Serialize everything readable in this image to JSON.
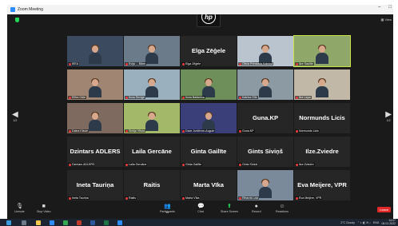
{
  "window": {
    "title": "Zoom Meeting",
    "minimize": "–",
    "maximize": "□"
  },
  "header": {
    "logo_text": "hp",
    "view_label": "View"
  },
  "nav": {
    "left_arrow": "◀",
    "left_page": "1/2",
    "right_arrow": "▶",
    "right_page": "1/2"
  },
  "tiles": [
    {
      "label": "IEEA",
      "big": "",
      "video": true
    },
    {
      "label": "Evija ... Bāne",
      "big": "",
      "video": true
    },
    {
      "label": "Elga Zēģele",
      "big": "Elga Zēģele",
      "video": false
    },
    {
      "label": "Olivia Prinstada Kalniņa",
      "big": "",
      "video": true
    },
    {
      "label": "Ilze Saulīte",
      "big": "",
      "video": true,
      "active": true
    },
    {
      "label": "Elītra Odle",
      "big": "",
      "video": true
    },
    {
      "label": "Ilona Ševige",
      "big": "",
      "video": true
    },
    {
      "label": "Ilona Baldzena",
      "big": "",
      "video": true
    },
    {
      "label": "Katrina Sīle",
      "big": "",
      "video": true
    },
    {
      "label": "Ilze Lepa",
      "big": "",
      "video": true
    },
    {
      "label": "Daina Kikule",
      "big": "",
      "video": true
    },
    {
      "label": "Sintija Vītola",
      "big": "",
      "video": true
    },
    {
      "label": "Dace Juršēvne-Augule",
      "big": "",
      "video": true
    },
    {
      "label": "Guna.KP",
      "big": "Guna.KP",
      "video": false
    },
    {
      "label": "Normunds Licis",
      "big": "Normunds Licis",
      "video": false
    },
    {
      "label": "Dzintars ADLERS",
      "big": "Dzintars ADLERS",
      "video": false
    },
    {
      "label": "Laila Gercāne",
      "big": "Laila Gercāne",
      "video": false
    },
    {
      "label": "Ginta Gailīte",
      "big": "Ginta Gailīte",
      "video": false
    },
    {
      "label": "Gints Sīviņš",
      "big": "Gints Siviņš",
      "video": false
    },
    {
      "label": "Ilze.Zviedre",
      "big": "Ilze.Zviedre",
      "video": false
    },
    {
      "label": "Ineta Tauriņa",
      "big": "Ineta Tauriņa",
      "video": false
    },
    {
      "label": "Raitis",
      "big": "Raitis",
      "video": false
    },
    {
      "label": "Marta Vīka",
      "big": "Marta Vīka",
      "video": false
    },
    {
      "label": "Rihards Loļa",
      "big": "",
      "video": true
    },
    {
      "label": "Eva Meijere, VPR",
      "big": "Eva Meijere, VPR",
      "video": false
    }
  ],
  "toolbar": {
    "unmute": "Unmute",
    "stop_video": "Stop Video",
    "participants": "Participants",
    "participants_count": "25",
    "chat": "Chat",
    "share_screen": "Share Screen",
    "record": "Record",
    "reactions": "Reactions",
    "leave": "Leave"
  },
  "taskbar": {
    "weather": "2°C Cloudy",
    "lang": "ENG",
    "time": "14:07",
    "date": "06.01.2022"
  },
  "colors": {
    "zoom_blue": "#2d8cff",
    "share_green": "#23d959",
    "leave_red": "#e02828",
    "active_border": "#c9e14a"
  }
}
